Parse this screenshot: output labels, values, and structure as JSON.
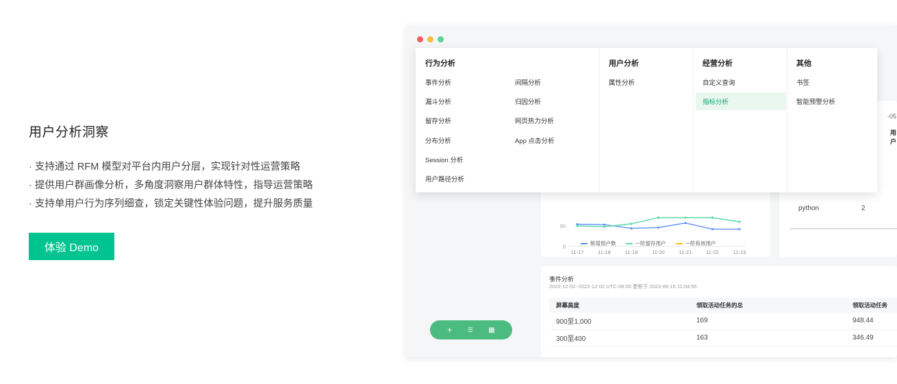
{
  "promo": {
    "title": "用户分析洞察",
    "bullets": [
      "· 支持通过 RFM 模型对平台内用户分层，实现针对性运营策略",
      "· 提供用户群画像分析，多角度洞察用户群体特性，指导运营策略",
      "· 支持单用户行为序列细查，锁定关键性体验问题，提升服务质量"
    ],
    "demo_button": "体验 Demo",
    "accent": "#00c48f"
  },
  "window_dots": [
    "#f0605a",
    "#f6be3a",
    "#5ccf9b"
  ],
  "menu": {
    "behavior": {
      "heading": "行为分析",
      "col1": [
        "事件分析",
        "漏斗分析",
        "留存分析",
        "分布分析",
        "Session 分析",
        "用户路径分析"
      ],
      "col2": [
        "间隔分析",
        "归因分析",
        "网页热力分析",
        "App 点击分析"
      ]
    },
    "user": {
      "heading": "用户分析",
      "items": [
        "属性分析"
      ]
    },
    "business": {
      "heading": "经营分析",
      "items": [
        "自定义查询",
        "指标分析"
      ],
      "active_index": 1
    },
    "other": {
      "heading": "其他",
      "items": [
        "书签",
        "智能预警分析"
      ]
    }
  },
  "chart_data": {
    "type": "line",
    "categories": [
      "11-17",
      "11-18",
      "11-19",
      "11-20",
      "11-21",
      "11-22",
      "11-23"
    ],
    "y_ticks": [
      "50",
      "0"
    ],
    "ylim": [
      0,
      100
    ],
    "series": [
      {
        "name": "新增用户数",
        "color": "#5b8ff9",
        "values": [
          54,
          53,
          44,
          46,
          57,
          42,
          42
        ]
      },
      {
        "name": "一阶留存用户",
        "color": "#5ad8a6",
        "values": [
          50,
          48,
          55,
          70,
          70,
          70,
          60
        ]
      },
      {
        "name": "一阶有效用户",
        "color": "#f6bd16",
        "values": []
      }
    ]
  },
  "side_panel": {
    "partial_date": "-05",
    "partial_header": "用户",
    "row": {
      "name": "python",
      "value": "2"
    }
  },
  "event_table": {
    "title": "事件分析",
    "subtitle": "2022-12-02~2022-12-02 UTC-08:00 更新于 2023-06-16 11:04:55",
    "columns": [
      "屏幕高度",
      "领取活动任务的总",
      "领取活动任务"
    ],
    "rows": [
      [
        "900至1,000",
        "169",
        "948.44"
      ],
      [
        "300至400",
        "163",
        "346.49"
      ]
    ]
  },
  "fab": {
    "add": "+",
    "list": "☰",
    "grid": "▦"
  }
}
